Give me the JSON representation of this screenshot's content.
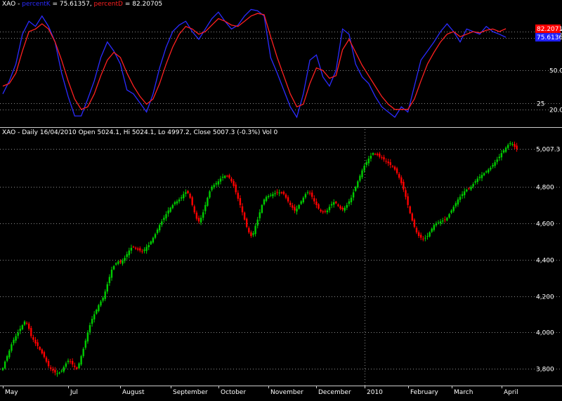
{
  "header_top": {
    "symbol": "XAO",
    "sep": " - ",
    "k_name": "percentK",
    "k_value": " = 75.61357, ",
    "d_name": "percentD",
    "d_value": " = 82.20705"
  },
  "header_bottom": {
    "text": "XAO - Daily 16/04/2010 Open 5024.1, Hi 5024.1, Lo 4997.2, Close 5007.3 (-0.3%) Vol 0"
  },
  "colors": {
    "background": "#000000",
    "up_candle": "#00cc00",
    "down_candle": "#ff0000",
    "percentK_line": "#2b2bff",
    "percentD_line": "#ff2020",
    "grid": "#8a8a8a",
    "badge_k": "#2020ff",
    "badge_d": "#ff0000"
  },
  "chart_data": [
    {
      "type": "line",
      "title": "XAO - percentK = 75.61357, percentD = 82.20705",
      "y_ticks": [
        "80.0",
        "75",
        "50.0",
        "25",
        "20.0"
      ],
      "y_tick_values": [
        80,
        75,
        50,
        25,
        20
      ],
      "ylim": [
        8,
        100
      ],
      "grid": true,
      "badges": [
        {
          "name": "percentD",
          "value_label": "82.2071",
          "value": 82.2071
        },
        {
          "name": "percentK",
          "value_label": "75.6136",
          "value": 75.6136
        }
      ],
      "series": [
        {
          "name": "percentK",
          "x": [
            0,
            3,
            6,
            9,
            12,
            15,
            18,
            21,
            24,
            27,
            30,
            33,
            36,
            39,
            42,
            45,
            48,
            51,
            54,
            57,
            60,
            63,
            66,
            69,
            72,
            75,
            78,
            81,
            84,
            87,
            90,
            93,
            96,
            99,
            102,
            105,
            108,
            111,
            114,
            117,
            120,
            123,
            126,
            129,
            132,
            135,
            138,
            141,
            144,
            147,
            150,
            153,
            156,
            159,
            162,
            165,
            168,
            171,
            174,
            177,
            180,
            183,
            186,
            189,
            192,
            195,
            198,
            201,
            204,
            207,
            210,
            213,
            216,
            219,
            222,
            225,
            228,
            231
          ],
          "values": [
            32,
            42,
            55,
            78,
            88,
            84,
            92,
            84,
            72,
            48,
            30,
            15,
            15,
            28,
            42,
            60,
            72,
            65,
            55,
            35,
            32,
            25,
            18,
            32,
            52,
            68,
            80,
            85,
            88,
            80,
            74,
            82,
            90,
            95,
            88,
            82,
            85,
            92,
            97,
            96,
            92,
            60,
            48,
            35,
            22,
            14,
            32,
            58,
            62,
            45,
            38,
            50,
            82,
            78,
            55,
            45,
            40,
            30,
            22,
            18,
            14,
            22,
            18,
            38,
            58,
            65,
            72,
            80,
            86,
            80,
            72,
            82,
            80,
            78,
            84,
            80,
            78,
            75.6
          ]
        },
        {
          "name": "percentD",
          "x": [
            0,
            3,
            6,
            9,
            12,
            15,
            18,
            21,
            24,
            27,
            30,
            33,
            36,
            39,
            42,
            45,
            48,
            51,
            54,
            57,
            60,
            63,
            66,
            69,
            72,
            75,
            78,
            81,
            84,
            87,
            90,
            93,
            96,
            99,
            102,
            105,
            108,
            111,
            114,
            117,
            120,
            123,
            126,
            129,
            132,
            135,
            138,
            141,
            144,
            147,
            150,
            153,
            156,
            159,
            162,
            165,
            168,
            171,
            174,
            177,
            180,
            183,
            186,
            189,
            192,
            195,
            198,
            201,
            204,
            207,
            210,
            213,
            216,
            219,
            222,
            225,
            228,
            231
          ],
          "values": [
            38,
            40,
            48,
            65,
            80,
            82,
            86,
            82,
            72,
            58,
            42,
            28,
            20,
            22,
            32,
            46,
            58,
            64,
            60,
            48,
            38,
            30,
            24,
            28,
            40,
            55,
            68,
            78,
            84,
            82,
            78,
            80,
            85,
            90,
            88,
            85,
            84,
            88,
            92,
            94,
            93,
            76,
            60,
            46,
            32,
            22,
            24,
            40,
            52,
            50,
            44,
            46,
            66,
            74,
            64,
            54,
            46,
            38,
            30,
            24,
            20,
            20,
            20,
            28,
            42,
            55,
            64,
            72,
            78,
            80,
            76,
            78,
            80,
            79,
            81,
            82,
            80,
            82.2
          ]
        }
      ]
    },
    {
      "type": "bar",
      "chart_kind": "ohlc-candlestick",
      "title": "XAO - Daily 16/04/2010 Open 5024.1, Hi 5024.1, Lo 4997.2, Close 5007.3 (-0.3%) Vol 0",
      "ylim": [
        3720,
        5070
      ],
      "y_ticks": [
        "5,007.3",
        "4,800",
        "4,600",
        "4,400",
        "4,200",
        "4,000",
        "3,800"
      ],
      "y_tick_values": [
        5007.3,
        4800,
        4600,
        4400,
        4200,
        4000,
        3800
      ],
      "grid": true,
      "x_labels": [
        "May",
        "Jul",
        "August",
        "September",
        "October",
        "November",
        "December",
        "2010",
        "February",
        "March",
        "April"
      ],
      "x_label_idx": [
        0,
        30,
        54,
        77,
        99,
        122,
        144,
        166,
        186,
        206,
        229
      ],
      "year_marker_idx": 166,
      "last": {
        "open": 5024.1,
        "high": 5024.1,
        "low": 4997.2,
        "close": 5007.3
      },
      "closes": [
        3805,
        3840,
        3870,
        3900,
        3935,
        3960,
        3980,
        4000,
        4020,
        4040,
        4060,
        4050,
        4020,
        3980,
        3960,
        3940,
        3925,
        3905,
        3885,
        3865,
        3840,
        3815,
        3800,
        3790,
        3780,
        3775,
        3780,
        3790,
        3810,
        3830,
        3845,
        3840,
        3825,
        3810,
        3800,
        3830,
        3870,
        3910,
        3955,
        4000,
        4040,
        4075,
        4100,
        4125,
        4150,
        4170,
        4190,
        4225,
        4265,
        4305,
        4345,
        4365,
        4380,
        4390,
        4385,
        4395,
        4410,
        4430,
        4450,
        4465,
        4470,
        4460,
        4455,
        4450,
        4445,
        4455,
        4470,
        4480,
        4500,
        4520,
        4540,
        4565,
        4590,
        4610,
        4630,
        4650,
        4670,
        4685,
        4700,
        4715,
        4720,
        4730,
        4742,
        4760,
        4770,
        4765,
        4740,
        4700,
        4660,
        4625,
        4610,
        4630,
        4660,
        4700,
        4740,
        4775,
        4800,
        4810,
        4820,
        4830,
        4845,
        4855,
        4860,
        4858,
        4850,
        4830,
        4805,
        4770,
        4735,
        4700,
        4660,
        4620,
        4580,
        4550,
        4530,
        4545,
        4585,
        4620,
        4660,
        4700,
        4730,
        4745,
        4750,
        4755,
        4760,
        4765,
        4770,
        4768,
        4765,
        4760,
        4740,
        4720,
        4700,
        4685,
        4670,
        4680,
        4700,
        4720,
        4740,
        4760,
        4770,
        4765,
        4745,
        4720,
        4700,
        4680,
        4665,
        4660,
        4665,
        4670,
        4690,
        4705,
        4715,
        4710,
        4695,
        4680,
        4675,
        4685,
        4700,
        4720,
        4740,
        4770,
        4800,
        4830,
        4860,
        4890,
        4915,
        4935,
        4955,
        4970,
        4985,
        4980,
        4975,
        4965,
        4960,
        4950,
        4940,
        4930,
        4920,
        4910,
        4895,
        4875,
        4850,
        4820,
        4785,
        4745,
        4700,
        4655,
        4615,
        4580,
        4550,
        4530,
        4520,
        4515,
        4520,
        4530,
        4550,
        4570,
        4590,
        4600,
        4605,
        4610,
        4615,
        4620,
        4630,
        4650,
        4670,
        4690,
        4710,
        4730,
        4745,
        4760,
        4775,
        4785,
        4790,
        4800,
        4815,
        4830,
        4845,
        4855,
        4865,
        4875,
        4885,
        4895,
        4905,
        4920,
        4935,
        4950,
        4965,
        4985,
        5000,
        5015,
        5030,
        5040,
        5035,
        5020,
        5007.3
      ]
    }
  ]
}
